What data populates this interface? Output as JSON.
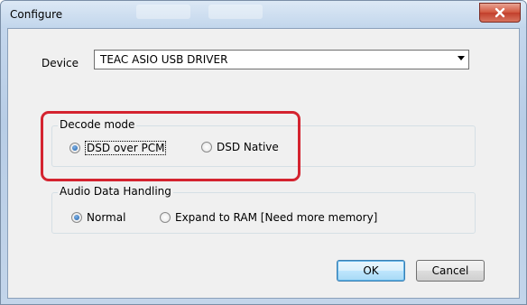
{
  "window": {
    "title": "Configure"
  },
  "device": {
    "label": "Device",
    "value": "TEAC ASIO USB DRIVER"
  },
  "decode_mode": {
    "title": "Decode mode",
    "options": [
      {
        "label": "DSD over PCM",
        "selected": true
      },
      {
        "label": "DSD Native",
        "selected": false
      }
    ]
  },
  "audio_data_handling": {
    "title": "Audio Data Handling",
    "options": [
      {
        "label": "Normal",
        "selected": true
      },
      {
        "label": "Expand to RAM [Need more memory]",
        "selected": false
      }
    ]
  },
  "buttons": {
    "ok": "OK",
    "cancel": "Cancel"
  },
  "colors": {
    "highlight": "#d4232f",
    "close_button": "#c8442f"
  }
}
